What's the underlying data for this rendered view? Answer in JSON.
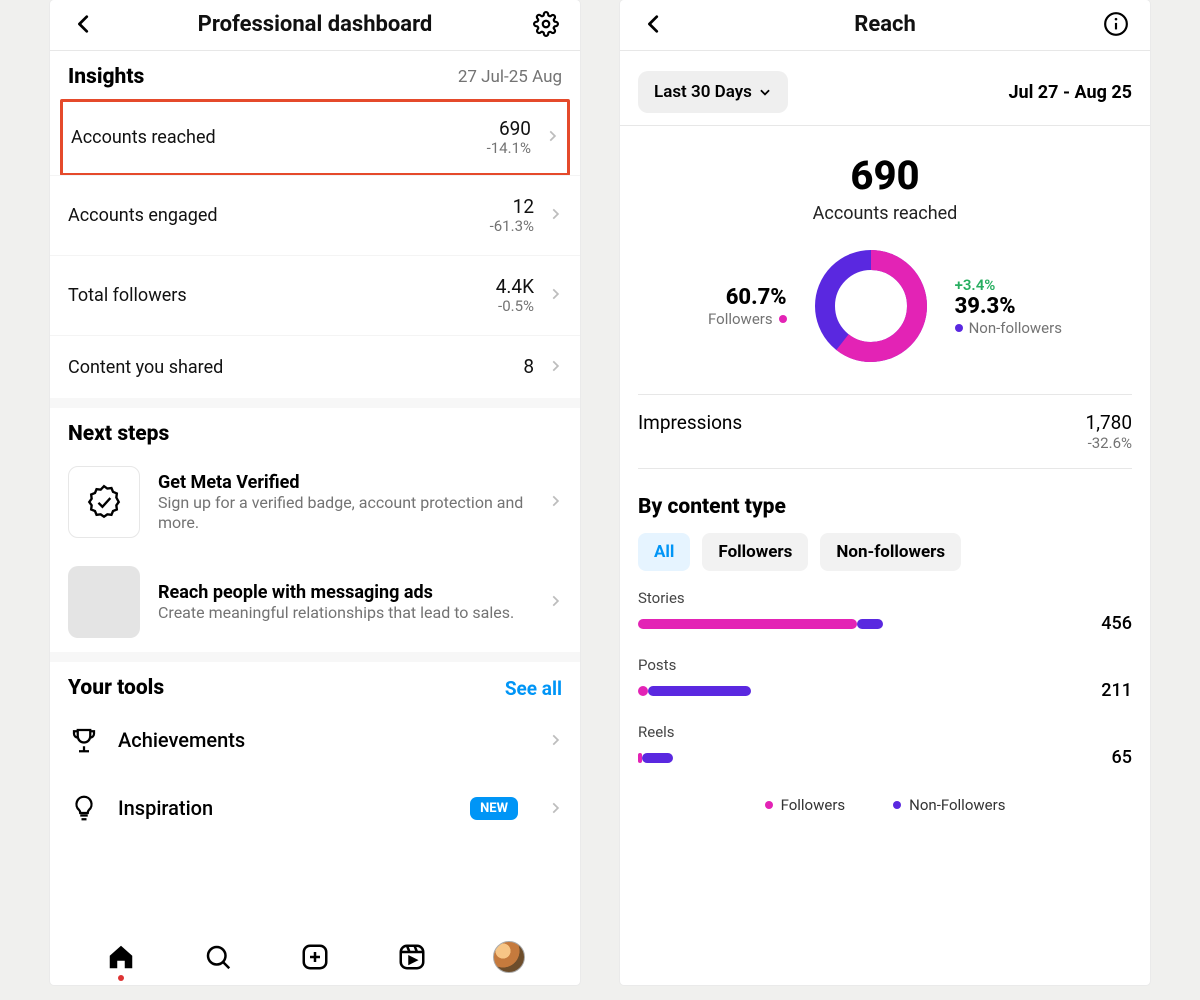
{
  "left": {
    "title": "Professional dashboard",
    "insights_header": "Insights",
    "date_range": "27 Jul-25 Aug",
    "rows": [
      {
        "label": "Accounts reached",
        "value": "690",
        "delta": "-14.1%"
      },
      {
        "label": "Accounts engaged",
        "value": "12",
        "delta": "-61.3%"
      },
      {
        "label": "Total followers",
        "value": "4.4K",
        "delta": "-0.5%"
      },
      {
        "label": "Content you shared",
        "value": "8",
        "delta": ""
      }
    ],
    "next_steps_header": "Next steps",
    "cards": [
      {
        "title": "Get Meta Verified",
        "subtitle": "Sign up for a verified badge, account protection and more."
      },
      {
        "title": "Reach people with messaging ads",
        "subtitle": "Create meaningful relationships that lead to sales."
      }
    ],
    "tools_header": "Your tools",
    "see_all": "See all",
    "tools": [
      {
        "label": "Achievements",
        "badge": ""
      },
      {
        "label": "Inspiration",
        "badge": "NEW"
      }
    ]
  },
  "right": {
    "title": "Reach",
    "range_button": "Last 30 Days",
    "range_text": "Jul 27 - Aug 25",
    "big_value": "690",
    "big_label": "Accounts reached",
    "donut": {
      "followers_pct": "60.7%",
      "followers_label": "Followers",
      "nonfollowers_pct": "39.3%",
      "nonfollowers_label": "Non-followers",
      "nonfollowers_delta": "+3.4%"
    },
    "impressions": {
      "label": "Impressions",
      "value": "1,780",
      "delta": "-32.6%"
    },
    "by_content_type": "By content type",
    "chips": [
      "All",
      "Followers",
      "Non-followers"
    ],
    "bars": [
      {
        "label": "Stories",
        "value": "456"
      },
      {
        "label": "Posts",
        "value": "211"
      },
      {
        "label": "Reels",
        "value": "65"
      }
    ],
    "legend": {
      "a": "Followers",
      "b": "Non-Followers"
    }
  },
  "chart_data": {
    "type": "donut+bar",
    "donut": {
      "series": [
        {
          "name": "Followers",
          "value": 60.7
        },
        {
          "name": "Non-followers",
          "value": 39.3
        }
      ],
      "colors": {
        "Followers": "#e323b5",
        "Non-followers": "#5a28e0"
      }
    },
    "bars": {
      "type": "bar",
      "categories": [
        "Stories",
        "Posts",
        "Reels"
      ],
      "series": [
        {
          "name": "Followers",
          "values": [
            410,
            18,
            8
          ]
        },
        {
          "name": "Non-followers",
          "values": [
            46,
            193,
            57
          ]
        }
      ],
      "totals": [
        456,
        211,
        65
      ],
      "max": 456,
      "title": "By content type"
    },
    "accounts_reached": 690,
    "impressions": 1780
  }
}
